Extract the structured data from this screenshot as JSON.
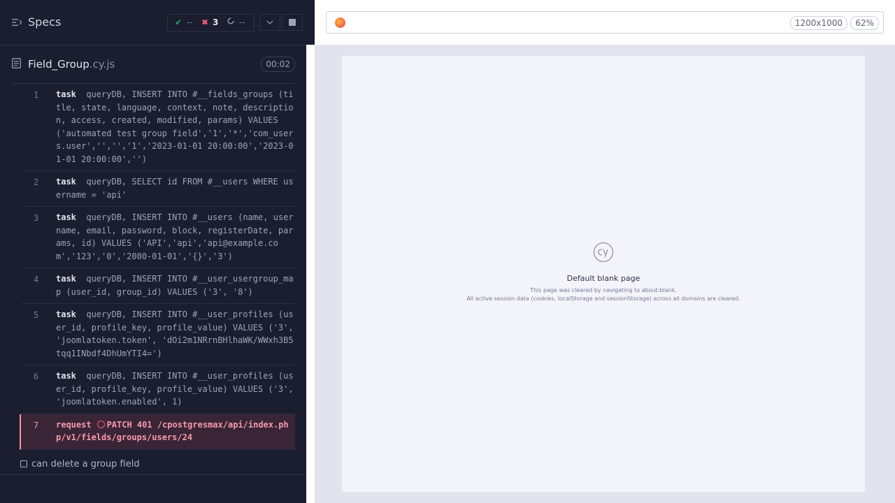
{
  "header": {
    "title": "Specs"
  },
  "stats": {
    "passed": "--",
    "failed": "3",
    "pending": "--"
  },
  "spec": {
    "name": "Field_Group",
    "ext": ".cy.js",
    "duration": "00:02"
  },
  "commands": [
    {
      "num": "1",
      "kw": "task",
      "text": "queryDB, INSERT INTO #__fields_groups (title, state, language, context, note, description, access, created, modified, params) VALUES ('automated test group field','1','*','com_users.user','','','1','2023-01-01 20:00:00','2023-01-01 20:00:00','')"
    },
    {
      "num": "2",
      "kw": "task",
      "text": "queryDB, SELECT id FROM #__users WHERE username = 'api'"
    },
    {
      "num": "3",
      "kw": "task",
      "text": "queryDB, INSERT INTO #__users (name, username, email, password, block, registerDate, params, id) VALUES ('API','api','api@example.com','123','0','2000-01-01','{}','3')"
    },
    {
      "num": "4",
      "kw": "task",
      "text": "queryDB, INSERT INTO #__user_usergroup_map (user_id, group_id) VALUES ('3', '8')"
    },
    {
      "num": "5",
      "kw": "task",
      "text": "queryDB, INSERT INTO #__user_profiles (user_id, profile_key, profile_value) VALUES ('3', 'joomlatoken.token', 'dOi2m1NRrnBHlhaWK/WWxh3B5tqq1INbdf4DhUmYTI4=')"
    },
    {
      "num": "6",
      "kw": "task",
      "text": "queryDB, INSERT INTO #__user_profiles (user_id, profile_key, profile_value) VALUES ('3', 'joomlatoken.enabled', 1)"
    },
    {
      "num": "7",
      "kw": "request",
      "text": "PATCH 401 /cpostgresmax/api/index.php/v1/fields/groups/users/24"
    }
  ],
  "test": {
    "title": "can delete a group field"
  },
  "viewport": {
    "size": "1200x1000",
    "zoom": "62%"
  },
  "blank_page": {
    "title": "Default blank page",
    "line1": "This page was cleared by navigating to about:blank.",
    "line2": "All active session data (cookies, localStorage and sessionStorage) across all domains are cleared."
  },
  "colors": {
    "failed": "#f25c74",
    "passed": "#1fa971",
    "error_bg": "#3a2537"
  }
}
